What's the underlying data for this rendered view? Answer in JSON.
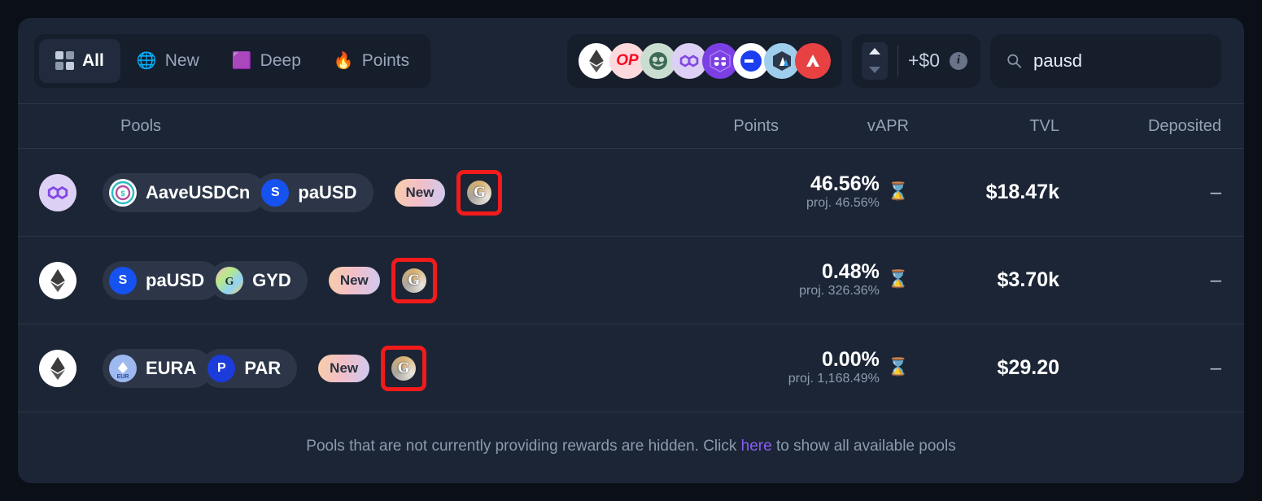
{
  "filters": {
    "tabs": [
      {
        "label": "All",
        "icon": "grid-icon",
        "active": true
      },
      {
        "label": "New",
        "icon": "sphere-icon",
        "glyph": "🌐",
        "active": false
      },
      {
        "label": "Deep",
        "icon": "cube-icon",
        "glyph": "🟪",
        "active": false
      },
      {
        "label": "Points",
        "icon": "fire-icon",
        "glyph": "🔥",
        "active": false
      }
    ]
  },
  "chains": [
    {
      "name": "ethereum",
      "label": "♦"
    },
    {
      "name": "optimism",
      "label": "OP"
    },
    {
      "name": "gnosis",
      "label": "◉"
    },
    {
      "name": "polygon",
      "label": "∞"
    },
    {
      "name": "base",
      "label": "⊟"
    },
    {
      "name": "linea",
      "label": "⊖"
    },
    {
      "name": "arbitrum",
      "label": "◩"
    },
    {
      "name": "avalanche",
      "label": "▲"
    }
  ],
  "budget": {
    "amount": "+$0",
    "info_icon": "info-icon"
  },
  "search": {
    "value": "pausd",
    "placeholder": "Search",
    "icon": "search-icon"
  },
  "table": {
    "headers": {
      "pools": "Pools",
      "points": "Points",
      "vapr": "vAPR",
      "tvl": "TVL",
      "deposited": "Deposited"
    },
    "rows": [
      {
        "chain": "polygon",
        "chain_glyph": "∞",
        "tokens": [
          {
            "symbol": "AaveUSDCn",
            "logo": "aave"
          },
          {
            "symbol": "paUSD",
            "logo": "pausd"
          }
        ],
        "badge": "New",
        "protocol_icon": "gyroscope-icon",
        "highlighted": true,
        "points": "",
        "vapr": "46.56%",
        "vapr_proj": "proj. 46.56%",
        "vapr_status_icon": "hourglass-icon",
        "tvl": "$18.47k",
        "deposited": "–"
      },
      {
        "chain": "ethereum",
        "chain_glyph": "♦",
        "tokens": [
          {
            "symbol": "paUSD",
            "logo": "pausd"
          },
          {
            "symbol": "GYD",
            "logo": "gyd"
          }
        ],
        "badge": "New",
        "protocol_icon": "gyroscope-icon",
        "highlighted": true,
        "points": "",
        "vapr": "0.48%",
        "vapr_proj": "proj. 326.36%",
        "vapr_status_icon": "hourglass-icon",
        "tvl": "$3.70k",
        "deposited": "–"
      },
      {
        "chain": "ethereum",
        "chain_glyph": "♦",
        "tokens": [
          {
            "symbol": "EURA",
            "logo": "eura"
          },
          {
            "symbol": "PAR",
            "logo": "par"
          }
        ],
        "badge": "New",
        "protocol_icon": "gyroscope-icon",
        "highlighted": true,
        "points": "",
        "vapr": "0.00%",
        "vapr_proj": "proj. 1,168.49%",
        "vapr_status_icon": "hourglass-icon",
        "tvl": "$29.20",
        "deposited": "–"
      }
    ],
    "footer": {
      "text_before": "Pools that are not currently providing rewards are hidden. Click",
      "link": "here",
      "text_after": "to show all available pools"
    }
  },
  "colors": {
    "card_bg": "#1c2535",
    "page_bg": "#0b0f18",
    "accent_link": "#8b5cf6",
    "highlight_red": "#f21b1b"
  }
}
